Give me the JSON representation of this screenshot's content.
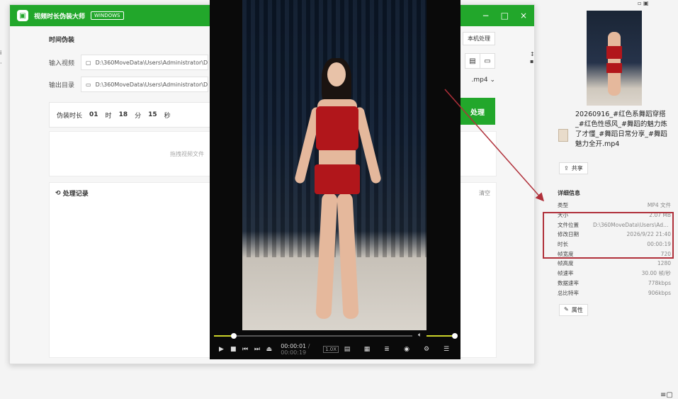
{
  "app": {
    "title": "视频时长伪装大师",
    "badge": "WINDOWS",
    "section_title": "时间伪装",
    "batch_label": "本机处理",
    "input_label": "输入视频",
    "input_path": "D:\\360MoveData\\Users\\Administrator\\Desktop",
    "output_label": "输出目录",
    "output_path": "D:\\360MoveData\\Users\\Administrator\\Desktop",
    "format": ".mp4",
    "duration_label": "伪装时长",
    "hours": "01",
    "hours_unit": "时",
    "minutes": "18",
    "minutes_unit": "分",
    "seconds": "15",
    "seconds_unit": "秒",
    "start_label": "处理",
    "drop_hint": "拖拽视频文件",
    "history_title": "处理记录",
    "clear_label": "清空"
  },
  "player": {
    "current_time": "00:00:01",
    "total_time": "/ 00:00:19",
    "speed": "1.0X",
    "progress": 0.1,
    "volume": 0.9
  },
  "file": {
    "name": "20260916_#红色系舞蹈穿搭_#红色性感风_#舞蹈的魅力炼了才懂_#舞蹈日常分享_#舞蹈魅力全开.mp4",
    "share_label": "共享",
    "details_title": "详细信息",
    "properties_label": "属性",
    "details": [
      {
        "k": "类型",
        "v": "MP4 文件"
      },
      {
        "k": "大小",
        "v": "2.07 MB"
      },
      {
        "k": "文件位置",
        "v": "D:\\360MoveData\\Users\\Administ..."
      },
      {
        "k": "修改日期",
        "v": "2026/9/22 21:40"
      },
      {
        "k": "时长",
        "v": "00:00:19"
      },
      {
        "k": "帧宽度",
        "v": "720"
      },
      {
        "k": "帧高度",
        "v": "1280"
      },
      {
        "k": "帧速率",
        "v": "30.00 帧/秒"
      },
      {
        "k": "数据速率",
        "v": "778kbps"
      },
      {
        "k": "总比特率",
        "v": "906kbps"
      }
    ]
  },
  "colors": {
    "accent": "#22a72b",
    "highlight_box": "#b0303a",
    "arrow": "#b0303a"
  }
}
